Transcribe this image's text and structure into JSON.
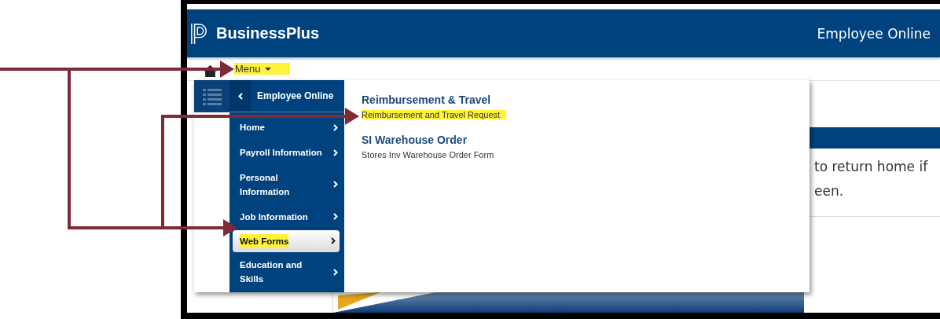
{
  "header": {
    "app_name": "BusinessPlus",
    "module": "Employee Online"
  },
  "toolbar": {
    "menu": {
      "label": "Menu",
      "highlighted": true
    }
  },
  "menu_popup": {
    "nav_title": "Employee Online",
    "nav_items": [
      {
        "label": "Home",
        "selected": false,
        "highlighted": false
      },
      {
        "label": "Payroll Information",
        "selected": false,
        "highlighted": false
      },
      {
        "label": "Personal Information",
        "selected": false,
        "highlighted": false
      },
      {
        "label": "Job Information",
        "selected": false,
        "highlighted": false
      },
      {
        "label": "Web Forms",
        "selected": true,
        "highlighted": true
      },
      {
        "label": "Education and Skills",
        "selected": false,
        "highlighted": false
      }
    ],
    "forms": [
      {
        "title": "Reimbursement & Travel",
        "description": "Reimbursement and Travel Request",
        "highlighted": true
      },
      {
        "title": "SI Warehouse Order",
        "description": "Stores Inv Warehouse Order Form",
        "highlighted": false
      }
    ]
  },
  "page": {
    "message": "to return home if\neen."
  }
}
